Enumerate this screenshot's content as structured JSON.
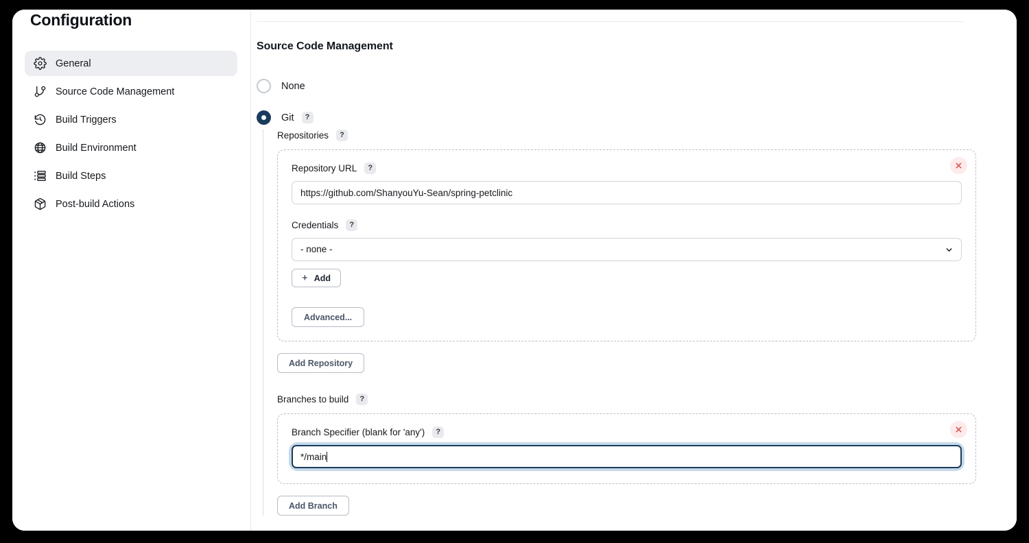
{
  "window": {
    "title": "Configuration"
  },
  "sidebar": {
    "items": [
      {
        "label": "General",
        "icon": "gear-icon",
        "active": true
      },
      {
        "label": "Source Code Management",
        "icon": "git-branch-icon",
        "active": false
      },
      {
        "label": "Build Triggers",
        "icon": "clock-icon",
        "active": false
      },
      {
        "label": "Build Environment",
        "icon": "globe-icon",
        "active": false
      },
      {
        "label": "Build Steps",
        "icon": "list-icon",
        "active": false
      },
      {
        "label": "Post-build Actions",
        "icon": "package-icon",
        "active": false
      }
    ]
  },
  "main": {
    "section_title": "Source Code Management",
    "scm_options": [
      {
        "label": "None",
        "selected": false,
        "help": null
      },
      {
        "label": "Git",
        "selected": true,
        "help": "?"
      }
    ],
    "repositories": {
      "label": "Repositories",
      "help": "?",
      "remove_icon": "close-icon",
      "repository_url": {
        "label": "Repository URL",
        "help": "?",
        "value": "https://github.com/ShanyouYu-Sean/spring-petclinic",
        "placeholder": ""
      },
      "credentials": {
        "label": "Credentials",
        "help": "?",
        "value": "- none -",
        "chevron_icon": "chevron-down-icon",
        "add_button": {
          "label": "Add",
          "icon": "plus-icon"
        }
      },
      "advanced_button": "Advanced...",
      "add_repository_button": "Add Repository"
    },
    "branches": {
      "label": "Branches to build",
      "help": "?",
      "remove_icon": "close-icon",
      "branch_specifier": {
        "label": "Branch Specifier (blank for 'any')",
        "help": "?",
        "value": "*/main",
        "focused": true
      },
      "add_branch_button": "Add Branch"
    }
  },
  "colors": {
    "accent_navy": "#1a3b5c",
    "focus_ring": "#c5d9ea",
    "remove_bg": "#fdeaea",
    "remove_fg": "#d94a4a",
    "sidebar_active_bg": "#eceef1"
  }
}
